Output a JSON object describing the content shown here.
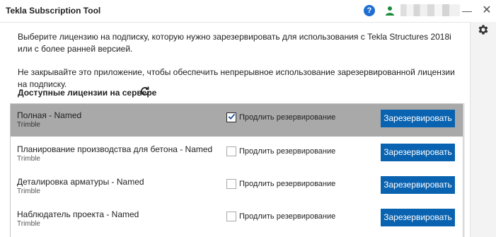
{
  "window": {
    "title": "Tekla Subscription Tool",
    "help_symbol": "?",
    "minimize_symbol": "—",
    "close_symbol": "✕"
  },
  "main": {
    "intro_text": "Выберите лицензию на подписку, которую нужно зарезервировать для использования с Tekla Structures 2018i или с более ранней версией.",
    "notice_text": "Не закрывайте это приложение, чтобы обеспечить непрерывное использование зарезервированной лицензии на подписку.",
    "section_title": "Доступные лицензии на сервере"
  },
  "licenses": [
    {
      "name": "Полная - Named",
      "vendor": "Trimble",
      "extend_label": "Продлить резервирование",
      "extend_checked": true,
      "button_label": "Зарезервировать",
      "selected": true
    },
    {
      "name": "Планирование производства для бетона - Named",
      "vendor": "Trimble",
      "extend_label": "Продлить резервирование",
      "extend_checked": false,
      "button_label": "Зарезервировать",
      "selected": false
    },
    {
      "name": "Деталировка арматуры - Named",
      "vendor": "Trimble",
      "extend_label": "Продлить резервирование",
      "extend_checked": false,
      "button_label": "Зарезервировать",
      "selected": false
    },
    {
      "name": "Наблюдатель проекта - Named",
      "vendor": "Trimble",
      "extend_label": "Продлить резервирование",
      "extend_checked": false,
      "button_label": "Зарезервировать",
      "selected": false
    }
  ],
  "colors": {
    "accent": "#0a63b0",
    "selected_row": "#a9a9a9",
    "help": "#1f6fd1",
    "user": "#1a8a3a"
  },
  "icons": {
    "help": "help-icon",
    "user": "user-icon",
    "settings": "gear-icon",
    "refresh": "refresh-icon"
  }
}
